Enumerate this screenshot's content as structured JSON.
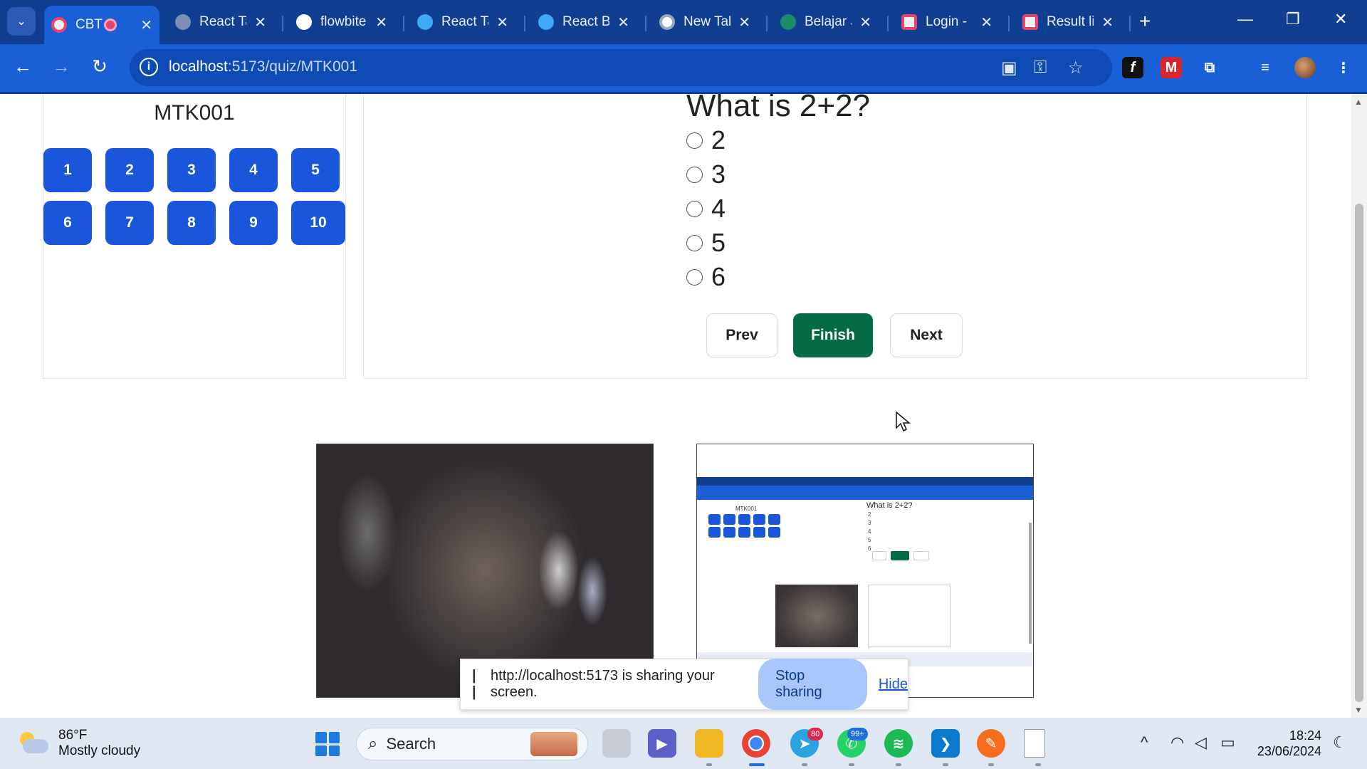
{
  "browser": {
    "tabs": [
      {
        "label": "CBT",
        "active": true
      },
      {
        "label": "React Ta",
        "active": false
      },
      {
        "label": "flowbite",
        "active": false
      },
      {
        "label": "React Ta",
        "active": false
      },
      {
        "label": "React B",
        "active": false
      },
      {
        "label": "New Tal",
        "active": false
      },
      {
        "label": "Belajar J",
        "active": false
      },
      {
        "label": "Login -",
        "active": false
      },
      {
        "label": "Result li",
        "active": false
      }
    ],
    "url_host": "localhost",
    "url_path": ":5173/quiz/MTK001"
  },
  "quiz": {
    "code": "MTK001",
    "question_numbers": [
      "1",
      "2",
      "3",
      "4",
      "5",
      "6",
      "7",
      "8",
      "9",
      "10"
    ],
    "question": "What is 2+2?",
    "options": [
      "2",
      "3",
      "4",
      "5",
      "6"
    ],
    "prev_label": "Prev",
    "finish_label": "Finish",
    "next_label": "Next"
  },
  "screen_share_preview": {
    "code": "MTK001",
    "question": "What is 2+2?",
    "options": [
      "2",
      "3",
      "4",
      "5",
      "6"
    ]
  },
  "share_bar": {
    "message": "http://localhost:5173 is sharing your screen.",
    "stop_label": "Stop sharing",
    "hide_label": "Hide"
  },
  "taskbar": {
    "weather_temp": "86°F",
    "weather_condition": "Mostly cloudy",
    "search_label": "Search",
    "telegram_badge": "80",
    "whatsapp_badge": "99+",
    "time": "18:24",
    "date": "23/06/2024"
  },
  "colors": {
    "primary": "#1a56db",
    "finish": "#056b45",
    "tabbar": "#103e91",
    "toolbar": "#1a5fd6"
  }
}
